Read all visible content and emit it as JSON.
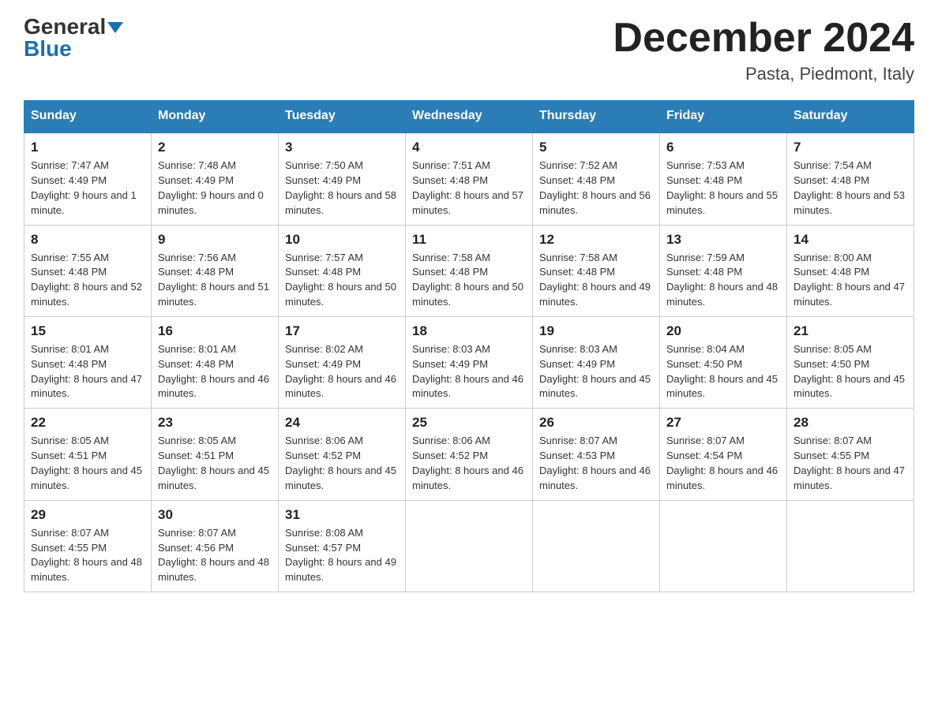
{
  "header": {
    "logo_general": "General",
    "logo_blue": "Blue",
    "month_title": "December 2024",
    "location": "Pasta, Piedmont, Italy"
  },
  "days_of_week": [
    "Sunday",
    "Monday",
    "Tuesday",
    "Wednesday",
    "Thursday",
    "Friday",
    "Saturday"
  ],
  "weeks": [
    [
      {
        "num": "1",
        "sunrise": "7:47 AM",
        "sunset": "4:49 PM",
        "daylight": "9 hours and 1 minute."
      },
      {
        "num": "2",
        "sunrise": "7:48 AM",
        "sunset": "4:49 PM",
        "daylight": "9 hours and 0 minutes."
      },
      {
        "num": "3",
        "sunrise": "7:50 AM",
        "sunset": "4:49 PM",
        "daylight": "8 hours and 58 minutes."
      },
      {
        "num": "4",
        "sunrise": "7:51 AM",
        "sunset": "4:48 PM",
        "daylight": "8 hours and 57 minutes."
      },
      {
        "num": "5",
        "sunrise": "7:52 AM",
        "sunset": "4:48 PM",
        "daylight": "8 hours and 56 minutes."
      },
      {
        "num": "6",
        "sunrise": "7:53 AM",
        "sunset": "4:48 PM",
        "daylight": "8 hours and 55 minutes."
      },
      {
        "num": "7",
        "sunrise": "7:54 AM",
        "sunset": "4:48 PM",
        "daylight": "8 hours and 53 minutes."
      }
    ],
    [
      {
        "num": "8",
        "sunrise": "7:55 AM",
        "sunset": "4:48 PM",
        "daylight": "8 hours and 52 minutes."
      },
      {
        "num": "9",
        "sunrise": "7:56 AM",
        "sunset": "4:48 PM",
        "daylight": "8 hours and 51 minutes."
      },
      {
        "num": "10",
        "sunrise": "7:57 AM",
        "sunset": "4:48 PM",
        "daylight": "8 hours and 50 minutes."
      },
      {
        "num": "11",
        "sunrise": "7:58 AM",
        "sunset": "4:48 PM",
        "daylight": "8 hours and 50 minutes."
      },
      {
        "num": "12",
        "sunrise": "7:58 AM",
        "sunset": "4:48 PM",
        "daylight": "8 hours and 49 minutes."
      },
      {
        "num": "13",
        "sunrise": "7:59 AM",
        "sunset": "4:48 PM",
        "daylight": "8 hours and 48 minutes."
      },
      {
        "num": "14",
        "sunrise": "8:00 AM",
        "sunset": "4:48 PM",
        "daylight": "8 hours and 47 minutes."
      }
    ],
    [
      {
        "num": "15",
        "sunrise": "8:01 AM",
        "sunset": "4:48 PM",
        "daylight": "8 hours and 47 minutes."
      },
      {
        "num": "16",
        "sunrise": "8:01 AM",
        "sunset": "4:48 PM",
        "daylight": "8 hours and 46 minutes."
      },
      {
        "num": "17",
        "sunrise": "8:02 AM",
        "sunset": "4:49 PM",
        "daylight": "8 hours and 46 minutes."
      },
      {
        "num": "18",
        "sunrise": "8:03 AM",
        "sunset": "4:49 PM",
        "daylight": "8 hours and 46 minutes."
      },
      {
        "num": "19",
        "sunrise": "8:03 AM",
        "sunset": "4:49 PM",
        "daylight": "8 hours and 45 minutes."
      },
      {
        "num": "20",
        "sunrise": "8:04 AM",
        "sunset": "4:50 PM",
        "daylight": "8 hours and 45 minutes."
      },
      {
        "num": "21",
        "sunrise": "8:05 AM",
        "sunset": "4:50 PM",
        "daylight": "8 hours and 45 minutes."
      }
    ],
    [
      {
        "num": "22",
        "sunrise": "8:05 AM",
        "sunset": "4:51 PM",
        "daylight": "8 hours and 45 minutes."
      },
      {
        "num": "23",
        "sunrise": "8:05 AM",
        "sunset": "4:51 PM",
        "daylight": "8 hours and 45 minutes."
      },
      {
        "num": "24",
        "sunrise": "8:06 AM",
        "sunset": "4:52 PM",
        "daylight": "8 hours and 45 minutes."
      },
      {
        "num": "25",
        "sunrise": "8:06 AM",
        "sunset": "4:52 PM",
        "daylight": "8 hours and 46 minutes."
      },
      {
        "num": "26",
        "sunrise": "8:07 AM",
        "sunset": "4:53 PM",
        "daylight": "8 hours and 46 minutes."
      },
      {
        "num": "27",
        "sunrise": "8:07 AM",
        "sunset": "4:54 PM",
        "daylight": "8 hours and 46 minutes."
      },
      {
        "num": "28",
        "sunrise": "8:07 AM",
        "sunset": "4:55 PM",
        "daylight": "8 hours and 47 minutes."
      }
    ],
    [
      {
        "num": "29",
        "sunrise": "8:07 AM",
        "sunset": "4:55 PM",
        "daylight": "8 hours and 48 minutes."
      },
      {
        "num": "30",
        "sunrise": "8:07 AM",
        "sunset": "4:56 PM",
        "daylight": "8 hours and 48 minutes."
      },
      {
        "num": "31",
        "sunrise": "8:08 AM",
        "sunset": "4:57 PM",
        "daylight": "8 hours and 49 minutes."
      },
      null,
      null,
      null,
      null
    ]
  ],
  "labels": {
    "sunrise": "Sunrise: ",
    "sunset": "Sunset: ",
    "daylight": "Daylight: "
  }
}
